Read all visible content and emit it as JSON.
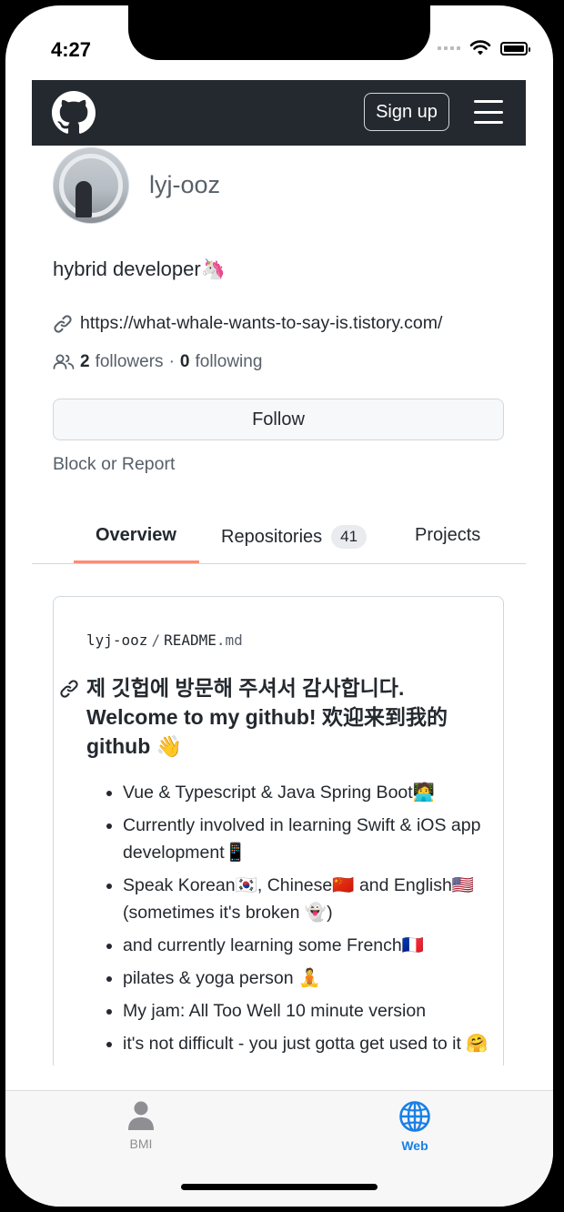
{
  "status_bar": {
    "time": "4:27"
  },
  "header": {
    "signup_label": "Sign up",
    "logo_icon": "github-octocat-icon",
    "menu_icon": "hamburger-menu-icon"
  },
  "profile": {
    "username": "lyj-ooz",
    "bio": "hybrid developer🦄",
    "url": "https://what-whale-wants-to-say-is.tistory.com/",
    "followers_count": "2",
    "followers_label": "followers",
    "separator": "·",
    "following_count": "0",
    "following_label": "following",
    "follow_label": "Follow",
    "block_label": "Block or Report"
  },
  "tabs": [
    {
      "label": "Overview",
      "active": true
    },
    {
      "label": "Repositories",
      "count": "41"
    },
    {
      "label": "Projects"
    }
  ],
  "readme": {
    "owner": "lyj-ooz",
    "sep": "/",
    "file": "README",
    "ext": ".md",
    "title": "제 깃헙에 방문해 주셔서 감사합니다. Welcome to my github! 欢迎来到我的 github 👋",
    "items": [
      "Vue & Typescript & Java Spring Boot🧑‍💻",
      "Currently involved in learning Swift & iOS app development📱",
      "Speak Korean🇰🇷, Chinese🇨🇳 and English🇺🇸 (sometimes it's broken 👻)",
      "and currently learning some French🇫🇷",
      "pilates & yoga person 🧘",
      "My jam: All Too Well 10 minute version",
      "it's not difficult - you just gotta get used to it 🤗"
    ]
  },
  "bottom_tabs": [
    {
      "label": "BMI",
      "icon": "person-icon",
      "color": "#8e8e93"
    },
    {
      "label": "Web",
      "icon": "globe-icon",
      "color": "#1a7fe6"
    }
  ]
}
